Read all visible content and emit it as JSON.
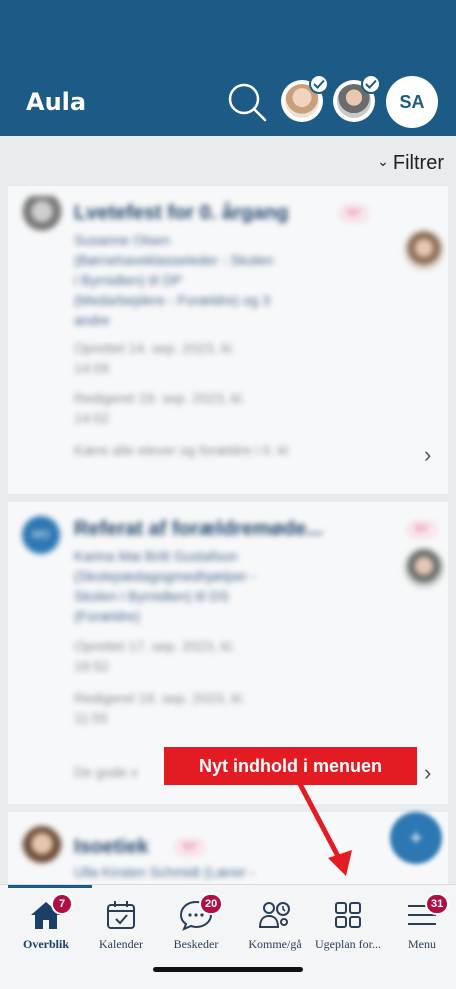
{
  "header": {
    "brand": "Aula",
    "profile_initials": "SA",
    "search_icon": "search-icon",
    "colors": {
      "header_bg": "#1b5b86"
    }
  },
  "toolbar": {
    "filter_label": "Filtrer"
  },
  "posts": [
    {
      "title": "Lvetefest for 0. årgang",
      "tag": "NY",
      "author_lines": [
        "Susanne Olsen",
        "(Børnehaveklasseleder - Skolen",
        "i Byrnidten) til DP",
        "(Medarbejdere - Forældre) og 3",
        "andre"
      ],
      "created": [
        "Oprettet 14. sep. 2023, kl.",
        "14:09"
      ],
      "edited": [
        "Redigeret 19. sep. 2023, kl.",
        "14:02"
      ],
      "preview": "Kære alle elever og forældre i 0. kl"
    },
    {
      "title": "Referat af forældremøde...",
      "tag": "NY",
      "avatar_initials": "MO",
      "author_lines": [
        "Karina Mai Britt Gustafson",
        "(Skolepædagogmedhjælper -",
        "Skolen i Byrnidten) til DS",
        "(Forældre)"
      ],
      "created": [
        "Oprettet 17. sep. 2023, kl.",
        "18:52"
      ],
      "edited": [
        "Redigeret 19. sep. 2023, kl.",
        "11:55"
      ],
      "preview": "De gode v"
    },
    {
      "title": "Isoetiek",
      "tag": "NY",
      "author_lines": [
        "Ulla Kirsten Schmidt (Lærer -"
      ]
    }
  ],
  "callout": {
    "text": "Nyt indhold i menuen",
    "color": "#e31b23"
  },
  "fab": {
    "label": "+"
  },
  "tabs": [
    {
      "label": "Overblik",
      "badge": "7",
      "icon": "home-icon"
    },
    {
      "label": "Kalender",
      "badge": "",
      "icon": "calendar-icon"
    },
    {
      "label": "Beskeder",
      "badge": "20",
      "icon": "chat-icon"
    },
    {
      "label": "Komme/gå",
      "badge": "",
      "icon": "people-clock-icon"
    },
    {
      "label": "Ugeplan for...",
      "badge": "",
      "icon": "grid-icon"
    },
    {
      "label": "Menu",
      "badge": "31",
      "icon": "menu-icon"
    }
  ]
}
